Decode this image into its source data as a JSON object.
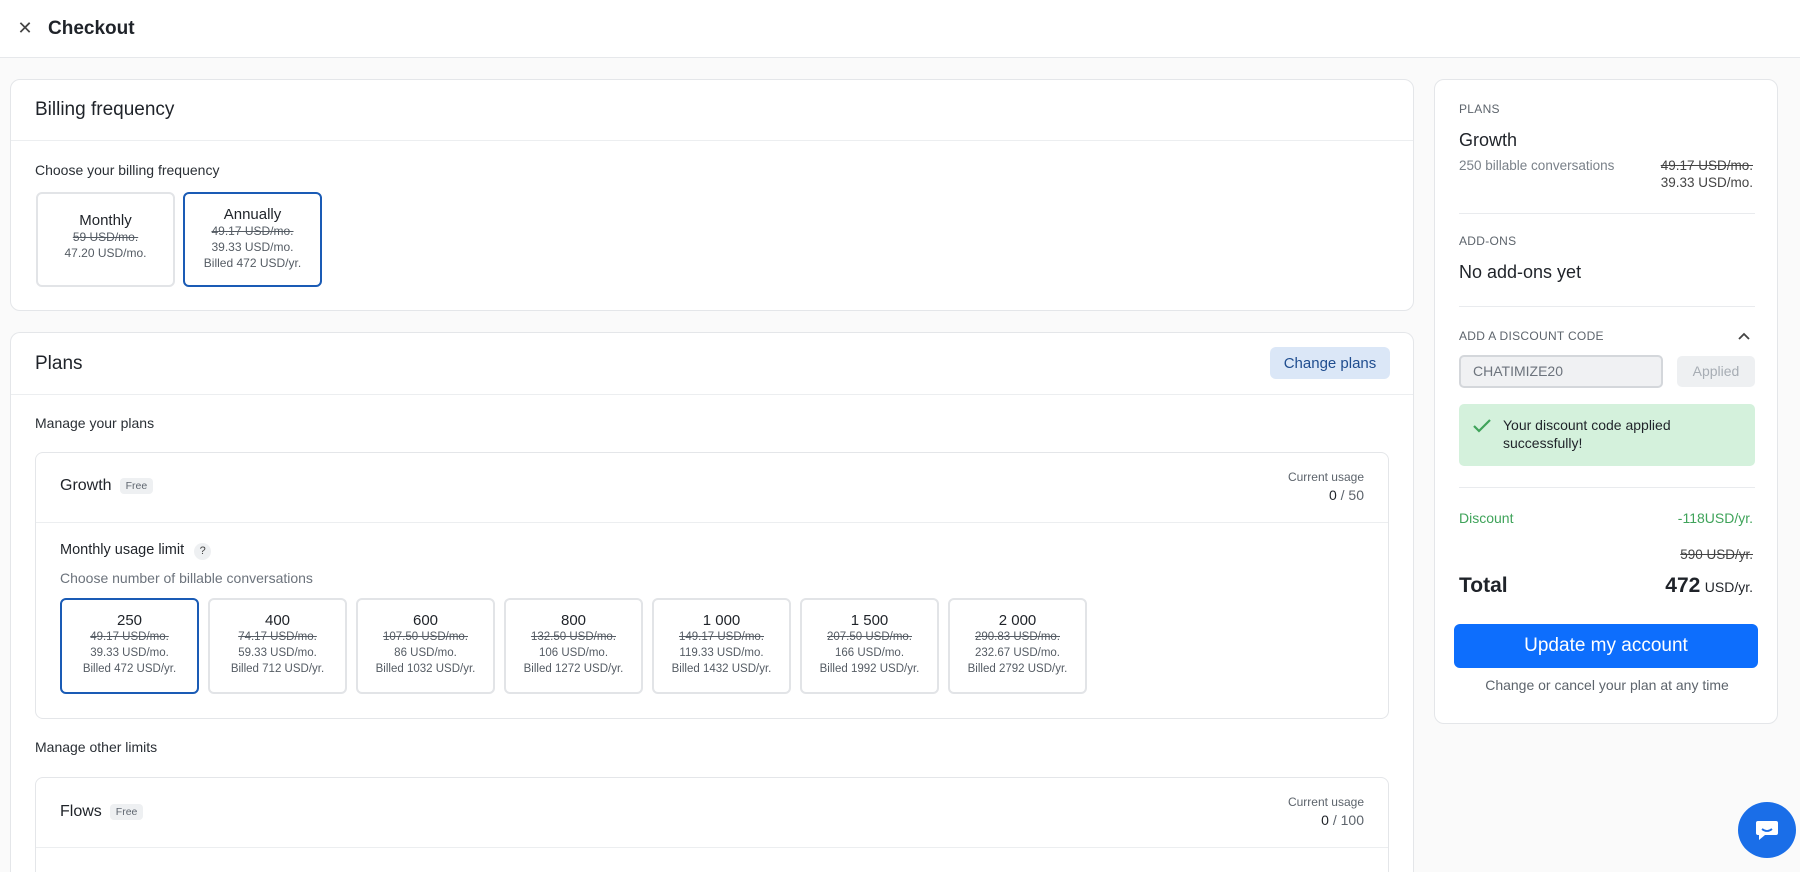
{
  "window": {
    "title": "Checkout"
  },
  "billing": {
    "title": "Billing frequency",
    "prompt": "Choose your billing frequency",
    "options": [
      {
        "label": "Monthly",
        "old": "59 USD/mo.",
        "price": "47.20 USD/mo.",
        "billed": ""
      },
      {
        "label": "Annually",
        "old": "49.17 USD/mo.",
        "price": "39.33 USD/mo.",
        "billed": "Billed 472 USD/yr."
      }
    ],
    "selected": "Annually"
  },
  "plans": {
    "title": "Plans",
    "change_label": "Change plans",
    "manage_label": "Manage your plans",
    "growth": {
      "name": "Growth",
      "badge": "Free",
      "usage_label": "Current usage",
      "usage_value": "0",
      "usage_limit": "/ 50",
      "limit_title": "Monthly usage limit",
      "limit_help": "?",
      "limit_subtitle": "Choose number of billable conversations",
      "tiers": [
        {
          "count": "250",
          "old": "49.17 USD/mo.",
          "price": "39.33 USD/mo.",
          "billed": "Billed 472 USD/yr."
        },
        {
          "count": "400",
          "old": "74.17 USD/mo.",
          "price": "59.33 USD/mo.",
          "billed": "Billed 712 USD/yr."
        },
        {
          "count": "600",
          "old": "107.50 USD/mo.",
          "price": "86 USD/mo.",
          "billed": "Billed 1032 USD/yr."
        },
        {
          "count": "800",
          "old": "132.50 USD/mo.",
          "price": "106 USD/mo.",
          "billed": "Billed 1272 USD/yr."
        },
        {
          "count": "1 000",
          "old": "149.17 USD/mo.",
          "price": "119.33 USD/mo.",
          "billed": "Billed 1432 USD/yr."
        },
        {
          "count": "1 500",
          "old": "207.50 USD/mo.",
          "price": "166 USD/mo.",
          "billed": "Billed 1992 USD/yr."
        },
        {
          "count": "2 000",
          "old": "290.83 USD/mo.",
          "price": "232.67 USD/mo.",
          "billed": "Billed 2792 USD/yr."
        }
      ],
      "selected": "250"
    },
    "other_label": "Manage other limits",
    "flows": {
      "name": "Flows",
      "badge": "Free",
      "usage_label": "Current usage",
      "usage_value": "0",
      "usage_limit": "/ 100"
    }
  },
  "summary": {
    "plans_label": "PLANS",
    "plan_name": "Growth",
    "plan_desc": "250 billable conversations",
    "plan_old": "49.17 USD/mo.",
    "plan_price": "39.33 USD/mo.",
    "addons_label": "ADD-ONS",
    "addons_value": "No add-ons yet",
    "discount_label": "ADD A DISCOUNT CODE",
    "discount_code": "CHATIMIZE20",
    "applied_label": "Applied",
    "success_msg": "Your discount code applied successfully!",
    "discount_row_label": "Discount",
    "discount_row_value": "-118USD/yr.",
    "subtotal_old": "590 USD/yr.",
    "total_label": "Total",
    "total_value": "472",
    "total_unit": "USD/yr.",
    "update_label": "Update my account",
    "footnote": "Change or cancel your plan at any time"
  },
  "colors": {
    "accent": "#0d6efd",
    "selected_border": "#1a5bb5",
    "success_bg": "#d4f1dc",
    "discount_green": "#3fa35a"
  },
  "icons": {
    "close": "close-icon",
    "check": "check-icon",
    "chevron": "chevron-up-icon",
    "chat": "chat-icon"
  }
}
